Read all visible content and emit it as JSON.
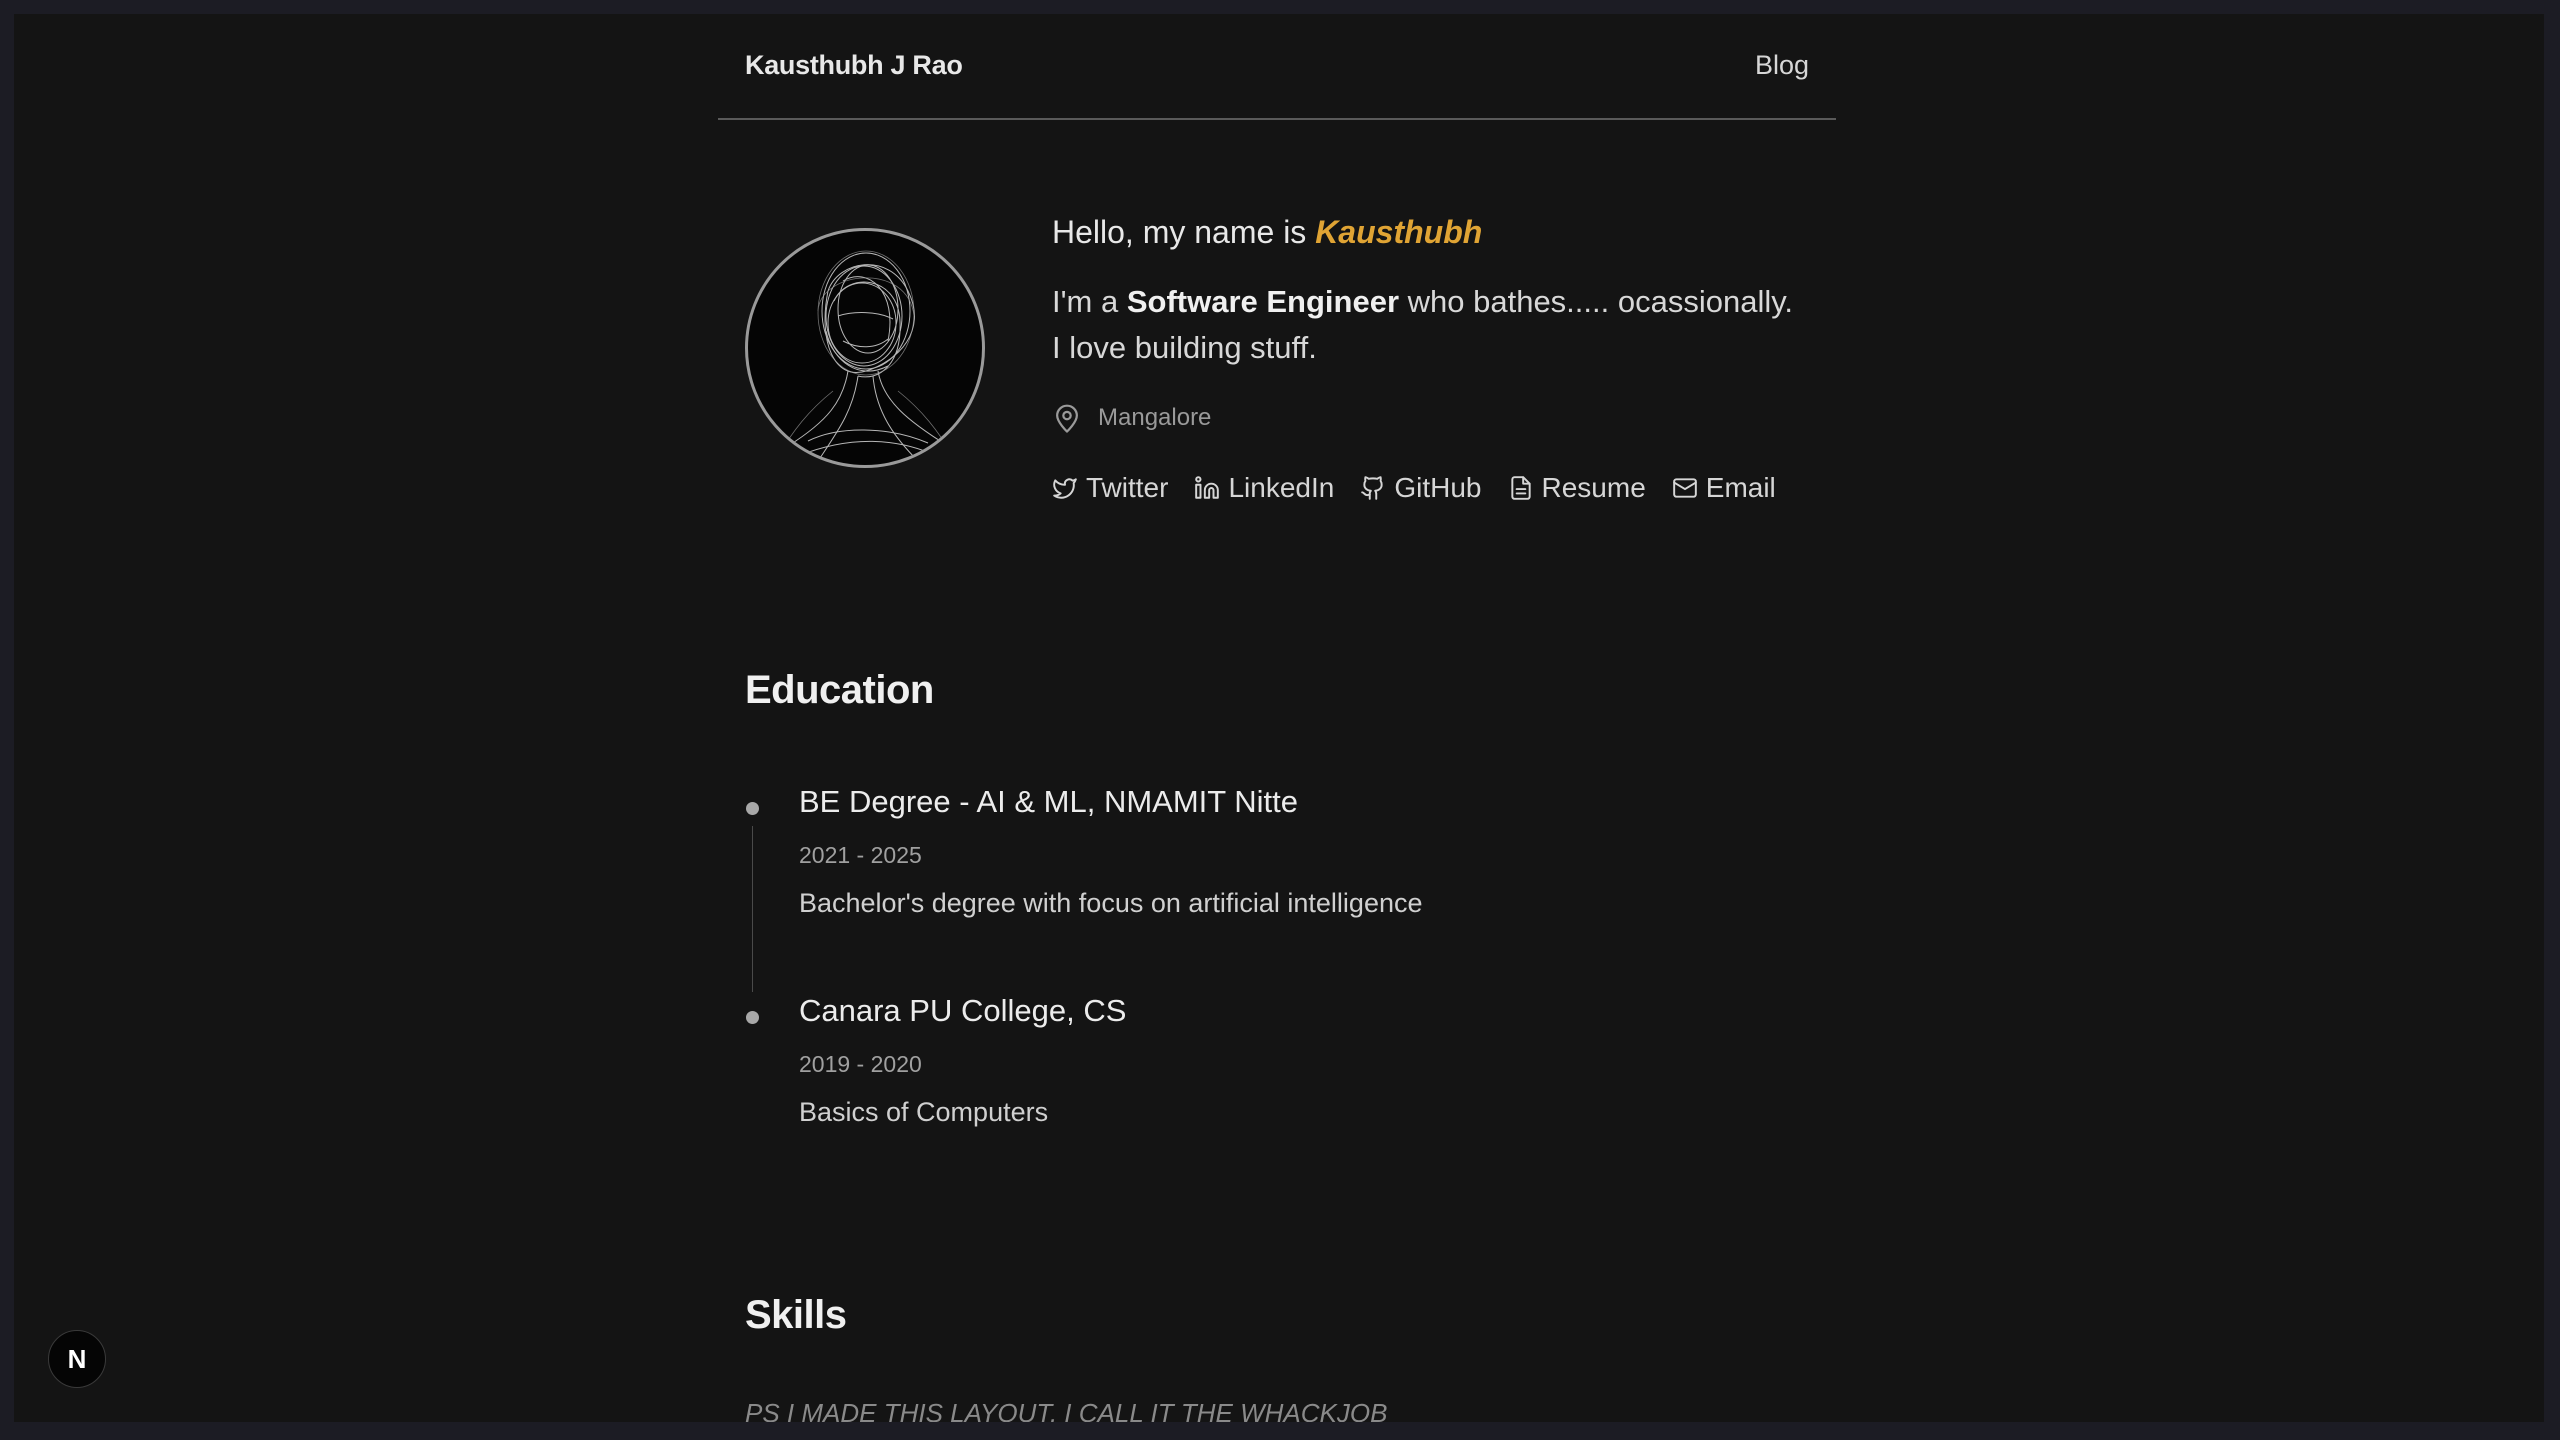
{
  "nav": {
    "brand": "Kausthubh J Rao",
    "blog_label": "Blog"
  },
  "hero": {
    "greeting_prefix": "Hello, my name is ",
    "greeting_name": "Kausthubh",
    "tagline_prefix": "I'm a ",
    "tagline_role": "Software Engineer",
    "tagline_suffix": " who bathes..... ocassionally.",
    "tagline_line2": "I love building stuff.",
    "location": "Mangalore",
    "links": [
      {
        "label": "Twitter",
        "icon": "twitter-icon"
      },
      {
        "label": "LinkedIn",
        "icon": "linkedin-icon"
      },
      {
        "label": "GitHub",
        "icon": "github-icon"
      },
      {
        "label": "Resume",
        "icon": "file-icon"
      },
      {
        "label": "Email",
        "icon": "mail-icon"
      }
    ]
  },
  "education": {
    "title": "Education",
    "items": [
      {
        "title": "BE Degree - AI & ML, NMAMIT Nitte",
        "years": "2021 - 2025",
        "description": "Bachelor's degree with focus on artificial intelligence"
      },
      {
        "title": "Canara PU College, CS",
        "years": "2019 - 2020",
        "description": "Basics of Computers"
      }
    ]
  },
  "skills": {
    "title": "Skills"
  },
  "footer_note": "PS I MADE THIS LAYOUT, I CALL IT THE WHACKJOB",
  "next_badge": "N",
  "colors": {
    "accent": "#e0a434",
    "background": "#141414"
  }
}
